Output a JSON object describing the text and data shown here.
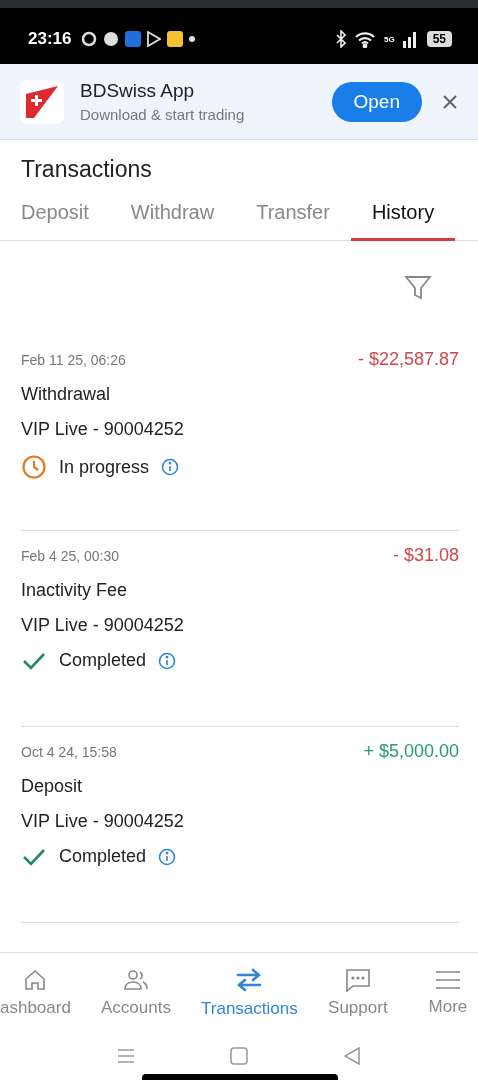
{
  "status_bar": {
    "time": "23:16",
    "network": "5G",
    "battery": "55"
  },
  "app_banner": {
    "title": "BDSwiss App",
    "subtitle": "Download & start trading",
    "button": "Open"
  },
  "header": {
    "title": "Transactions"
  },
  "tabs": [
    {
      "label": "Deposit",
      "selected": false
    },
    {
      "label": "Withdraw",
      "selected": false
    },
    {
      "label": "Transfer",
      "selected": false
    },
    {
      "label": "History",
      "selected": true
    }
  ],
  "transactions": [
    {
      "date": "Feb 11 25, 06:26",
      "amount": {
        "text": "- $22,587.87",
        "kind": "debit"
      },
      "type": "Withdrawal",
      "account": "VIP Live - 90004252",
      "status": {
        "text": "In progress",
        "kind": "pending"
      }
    },
    {
      "date": "Feb 4 25, 00:30",
      "amount": {
        "text": "- $31.08",
        "kind": "debit"
      },
      "type": "Inactivity Fee",
      "account": "VIP Live - 90004252",
      "status": {
        "text": "Completed",
        "kind": "done"
      }
    },
    {
      "date": "Oct 4 24, 15:58",
      "amount": {
        "text": "+ $5,000.00",
        "kind": "credit"
      },
      "type": "Deposit",
      "account": "VIP Live - 90004252",
      "status": {
        "text": "Completed",
        "kind": "done"
      }
    }
  ],
  "bottom_nav": [
    {
      "label": "ashboard",
      "selected": false
    },
    {
      "label": "Accounts",
      "selected": false
    },
    {
      "label": "Transactions",
      "selected": true
    },
    {
      "label": "Support",
      "selected": false
    },
    {
      "label": "More",
      "selected": false
    }
  ]
}
